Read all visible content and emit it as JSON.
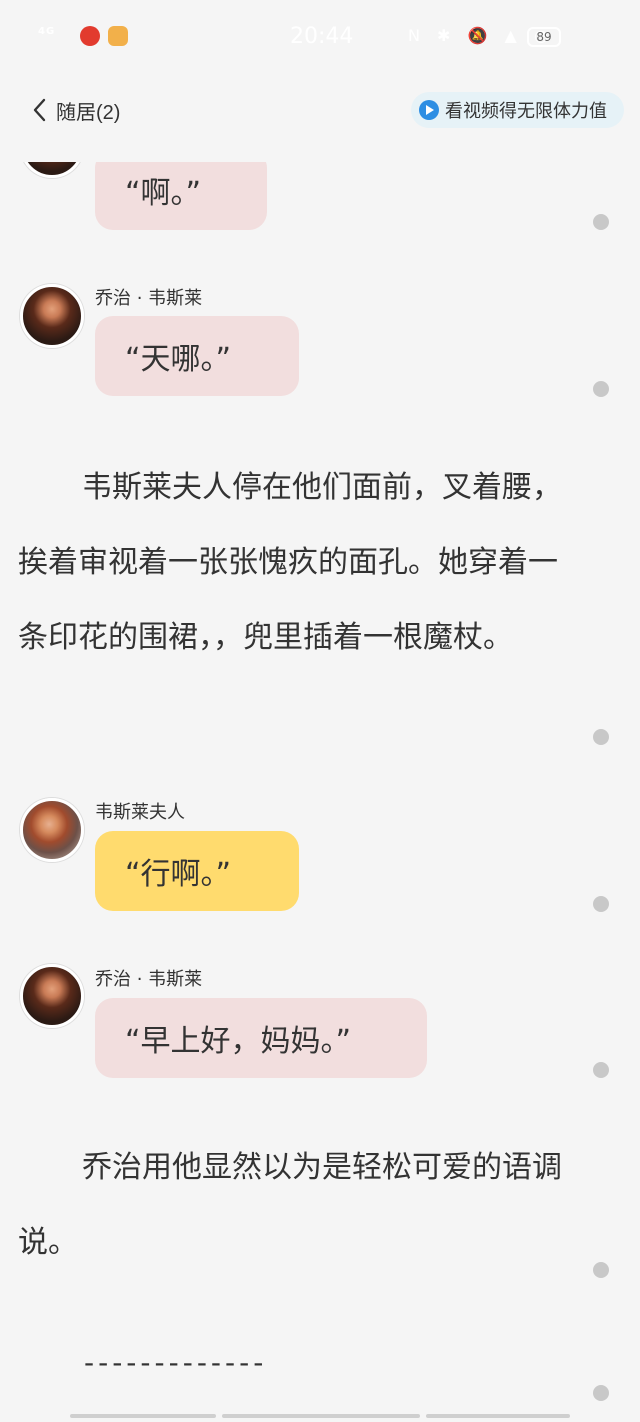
{
  "status_bar": {
    "signal": "4G",
    "time": "20:44",
    "icons": "N ✱ 🔕 ▲ ◔",
    "battery": "89"
  },
  "header": {
    "back_title": "随居(2)",
    "promo_label": "看视频得无限体力值"
  },
  "messages": [
    {
      "bubble_text": "“啊。”"
    },
    {
      "speaker": "乔治 · 韦斯莱",
      "bubble_text": "“天哪。”"
    },
    {
      "speaker": "韦斯莱夫人",
      "bubble_text": "“行啊。”"
    },
    {
      "speaker": "乔治 · 韦斯莱",
      "bubble_text": "“早上好，妈妈。”"
    }
  ],
  "narrations": [
    "韦斯莱夫人停在他们面前，叉着腰，挨着审视着一张张愧疚的面孔。她穿着一条印花的围裙，，兜里插着一根魔杖。",
    "乔治用他显然以为是轻松可爱的语调说。"
  ],
  "divider": "-------------",
  "colors": {
    "background": "#f5f5f5",
    "bubble_pink": "#f2dede",
    "bubble_yellow": "#ffdb6e",
    "promo_bg": "#e6f2f7",
    "play_blue": "#2d8ee3"
  },
  "icons": {
    "back": "chevron-left-icon",
    "play": "play-icon",
    "comment_dot": "dot-icon"
  }
}
